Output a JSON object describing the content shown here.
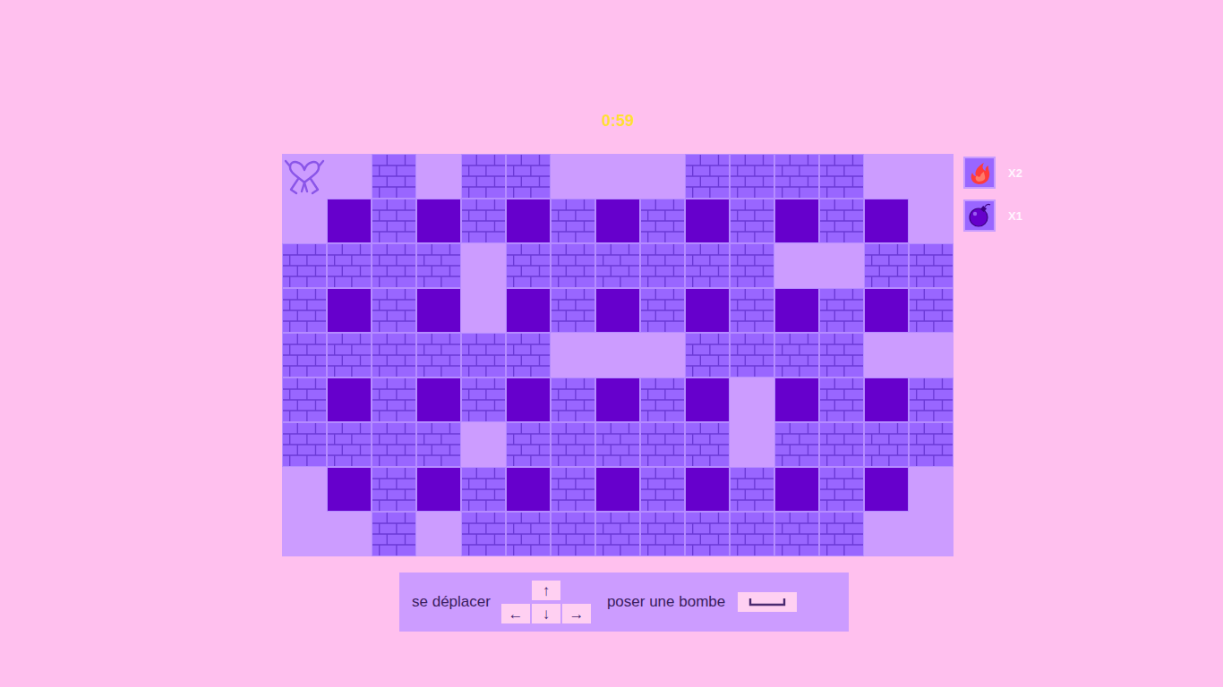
{
  "timer": "0:59",
  "board": {
    "rows": [
      [
        "player",
        "empty",
        "brick",
        "empty",
        "brick",
        "brick",
        "empty",
        "empty",
        "empty",
        "brick",
        "brick",
        "brick",
        "brick",
        "empty",
        "empty"
      ],
      [
        "empty",
        "solid",
        "brick",
        "solid",
        "brick",
        "solid",
        "brick",
        "solid",
        "brick",
        "solid",
        "brick",
        "solid",
        "brick",
        "solid",
        "empty"
      ],
      [
        "brick",
        "brick",
        "brick",
        "brick",
        "empty",
        "brick",
        "brick",
        "brick",
        "brick",
        "brick",
        "brick",
        "empty",
        "empty",
        "brick",
        "brick"
      ],
      [
        "brick",
        "solid",
        "brick",
        "solid",
        "empty",
        "solid",
        "brick",
        "solid",
        "brick",
        "solid",
        "brick",
        "solid",
        "brick",
        "solid",
        "brick"
      ],
      [
        "brick",
        "brick",
        "brick",
        "brick",
        "brick",
        "brick",
        "empty",
        "empty",
        "empty",
        "brick",
        "brick",
        "brick",
        "brick",
        "empty",
        "empty"
      ],
      [
        "brick",
        "solid",
        "brick",
        "solid",
        "brick",
        "solid",
        "brick",
        "solid",
        "brick",
        "solid",
        "empty",
        "solid",
        "brick",
        "solid",
        "brick"
      ],
      [
        "brick",
        "brick",
        "brick",
        "brick",
        "empty",
        "brick",
        "brick",
        "brick",
        "brick",
        "brick",
        "empty",
        "brick",
        "brick",
        "brick",
        "brick"
      ],
      [
        "empty",
        "solid",
        "brick",
        "solid",
        "brick",
        "solid",
        "brick",
        "solid",
        "brick",
        "solid",
        "brick",
        "solid",
        "brick",
        "solid",
        "empty"
      ],
      [
        "empty",
        "empty",
        "brick",
        "empty",
        "brick",
        "brick",
        "brick",
        "brick",
        "brick",
        "brick",
        "brick",
        "brick",
        "brick",
        "empty",
        "empty"
      ]
    ]
  },
  "powerups": [
    {
      "kind": "fire",
      "count": "X2"
    },
    {
      "kind": "bomb",
      "count": "X1"
    }
  ],
  "controls": {
    "move_label": "se déplacer",
    "arrows": {
      "up": "↑",
      "left": "←",
      "down": "↓",
      "right": "→"
    },
    "bomb_label": "poser une bombe"
  }
}
